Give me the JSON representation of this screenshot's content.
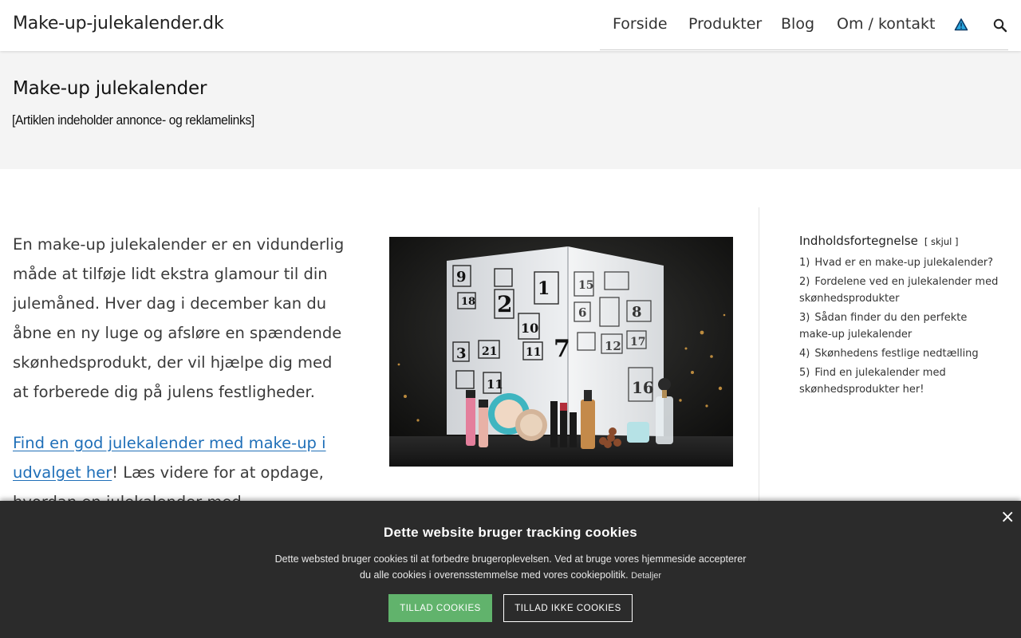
{
  "header": {
    "site_title": "Make-up-julekalender.dk",
    "nav": [
      {
        "label": "Forside"
      },
      {
        "label": "Produkter"
      },
      {
        "label": "Blog"
      },
      {
        "label": "Om / kontakt"
      }
    ],
    "icons": {
      "warning": "warning-triangle-icon",
      "search": "search-icon"
    }
  },
  "band": {
    "title": "Make-up julekalender",
    "disclaimer": "[Artiklen indeholder annonce- og reklamelinks]"
  },
  "content": {
    "intro": "En make-up julekalender er en vidunderlig måde at tilføje lidt ekstra glamour til din julemåned. Hver dag i december kan du åbne en ny luge og afsløre en spændende skønhedsprodukt, der vil hjælpe dig med at forberede dig på julens festligheder.",
    "link_text": "Find en god julekalender med make-up i udvalget her",
    "after_link": "! Læs videre for at opdage, hvordan en julekalender med"
  },
  "hero_image": {
    "door_numbers": [
      "9",
      "1",
      "15",
      "18",
      "2",
      "6",
      "8",
      "10",
      "3",
      "21",
      "11",
      "7",
      "12",
      "17",
      "11",
      "16"
    ]
  },
  "toc": {
    "title": "Indholdsfortegnelse",
    "toggle": "[ skjul ]",
    "items": [
      {
        "num": "1)",
        "label": "Hvad er en make-up julekalender?"
      },
      {
        "num": "2)",
        "label": "Fordelene ved en julekalender med skønhedsprodukter"
      },
      {
        "num": "3)",
        "label": "Sådan finder du den perfekte make-up julekalender"
      },
      {
        "num": "4)",
        "label": "Skønhedens festlige nedtælling"
      },
      {
        "num": "5)",
        "label": "Find en julekalender med skønhedsprodukter her!"
      }
    ]
  },
  "cookie": {
    "title": "Dette website bruger tracking cookies",
    "text": "Dette websted bruger cookies til at forbedre brugeroplevelsen. Ved at bruge vores hjemmeside accepterer du alle cookies i overensstemmelse med vores cookiepolitik.",
    "details": "Detaljer",
    "allow": "TILLAD COOKIES",
    "deny": "TILLAD IKKE COOKIES",
    "close": "×"
  },
  "colors": {
    "link": "#1f6fb8",
    "band_bg": "#f4f4f4",
    "cookie_bg": "#2b2b2b",
    "allow_btn": "#61b36c",
    "warning_icon": "#2aa7df"
  }
}
